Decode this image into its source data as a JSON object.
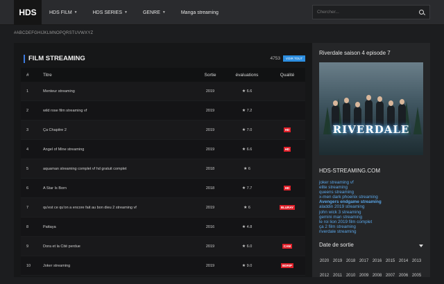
{
  "header": {
    "logo": "HDS",
    "nav": [
      {
        "label": "HDS FILM",
        "caret": "▼"
      },
      {
        "label": "HDS SERIES",
        "caret": "▼"
      },
      {
        "label": "GENRE",
        "caret": "▼"
      },
      {
        "label": "Manga streaming",
        "caret": ""
      }
    ],
    "search_placeholder": "Chercher..."
  },
  "alphabet": "#ABCDEFGHIJKLMNOPQRSTUVWXYZ",
  "main": {
    "title": "FILM STREAMING",
    "count": "4753",
    "view_all": "VOIR TOUT",
    "columns": [
      "#",
      "Titre",
      "Sortie",
      "évaluations",
      "Qualité"
    ],
    "rows": [
      {
        "num": "1",
        "title": "Menteur streaming",
        "year": "2019",
        "rating": "6.6",
        "quality": ""
      },
      {
        "num": "2",
        "title": "wild rose film streaming vf",
        "year": "2019",
        "rating": "7.2",
        "quality": ""
      },
      {
        "num": "3",
        "title": "Ça Chapitre 2",
        "year": "2019",
        "rating": "7.0",
        "quality": "HD"
      },
      {
        "num": "4",
        "title": "Angel of Mine streaming",
        "year": "2019",
        "rating": "6.6",
        "quality": "HD"
      },
      {
        "num": "5",
        "title": "aquaman streaming complet vf hd gratuit complet",
        "year": "2018",
        "rating": "6",
        "quality": ""
      },
      {
        "num": "6",
        "title": "A Star Is Born",
        "year": "2018",
        "rating": "7.7",
        "quality": "HD"
      },
      {
        "num": "7",
        "title": "qu'est ce qu'on a encore fait au bon dieu 2 streaming vf",
        "year": "2019",
        "rating": "6",
        "quality": "BLURAY"
      },
      {
        "num": "8",
        "title": "Pattaya",
        "year": "2016",
        "rating": "4.8",
        "quality": ""
      },
      {
        "num": "9",
        "title": "Dora et la Cité perdue",
        "year": "2019",
        "rating": "6.0",
        "quality": "CAM"
      },
      {
        "num": "10",
        "title": "Joker streaming",
        "year": "2019",
        "rating": "9.0",
        "quality": "BDRIP"
      }
    ]
  },
  "sidebar": {
    "featured_title": "Riverdale saison 4 episode 7",
    "poster_text": "RIVERDALE",
    "section_title": "HDS-STREAMING.COM",
    "links": [
      {
        "label": "joker streaming vf",
        "bold": false
      },
      {
        "label": "elite streaming",
        "bold": false
      },
      {
        "label": "queens streaming",
        "bold": false
      },
      {
        "label": "x-men dark phoenix streaming",
        "bold": false
      },
      {
        "label": "Avengers endgame streaming",
        "bold": true
      },
      {
        "label": "aladdin 2019 streaming",
        "bold": false
      },
      {
        "label": "john wick 3 streaming",
        "bold": false
      },
      {
        "label": "gemini man streaming",
        "bold": false
      },
      {
        "label": "le roi lion 2019 film complet",
        "bold": false
      },
      {
        "label": "ça 2 film streaming",
        "bold": false
      },
      {
        "label": "riverdale streaming",
        "bold": false
      }
    ],
    "dropdown_label": "Date de sortie",
    "years": [
      "2020",
      "2019",
      "2018",
      "2017",
      "2016",
      "2015",
      "2014",
      "2013",
      "2012",
      "2011",
      "2010",
      "2009",
      "2008",
      "2007",
      "2006",
      "2005"
    ]
  },
  "colors": {
    "accent": "#3d7be0",
    "badge": "#e0202a",
    "link": "#5aa6e8"
  }
}
